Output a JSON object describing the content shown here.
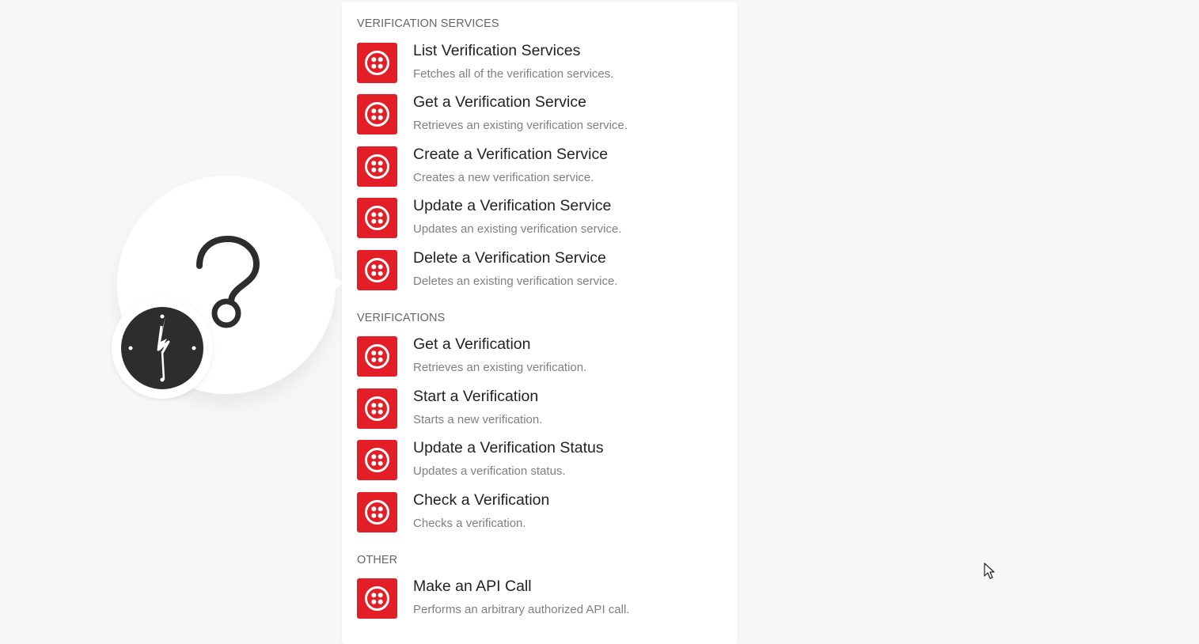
{
  "colors": {
    "accent": "#e31e26",
    "background": "#f7f7f7",
    "panel": "#ffffff",
    "icon_dark": "#2d2d2d"
  },
  "module": {
    "icon": "question-mark-icon",
    "badge_icon": "clock-icon"
  },
  "menu": {
    "sections": [
      {
        "title": "VERIFICATION SERVICES",
        "items": [
          {
            "icon": "twilio-icon",
            "title": "List Verification Services",
            "description": "Fetches all of the verification services."
          },
          {
            "icon": "twilio-icon",
            "title": "Get a Verification Service",
            "description": "Retrieves an existing verification service."
          },
          {
            "icon": "twilio-icon",
            "title": "Create a Verification Service",
            "description": "Creates a new verification service."
          },
          {
            "icon": "twilio-icon",
            "title": "Update a Verification Service",
            "description": "Updates an existing verification service."
          },
          {
            "icon": "twilio-icon",
            "title": "Delete a Verification Service",
            "description": "Deletes an existing verification service."
          }
        ]
      },
      {
        "title": "VERIFICATIONS",
        "items": [
          {
            "icon": "twilio-icon",
            "title": "Get a Verification",
            "description": "Retrieves an existing verification."
          },
          {
            "icon": "twilio-icon",
            "title": "Start a Verification",
            "description": "Starts a new verification."
          },
          {
            "icon": "twilio-icon",
            "title": "Update a Verification Status",
            "description": "Updates a verification status."
          },
          {
            "icon": "twilio-icon",
            "title": "Check a Verification",
            "description": "Checks a verification."
          }
        ]
      },
      {
        "title": "OTHER",
        "items": [
          {
            "icon": "twilio-icon",
            "title": "Make an API Call",
            "description": "Performs an arbitrary authorized API call."
          }
        ]
      }
    ]
  }
}
